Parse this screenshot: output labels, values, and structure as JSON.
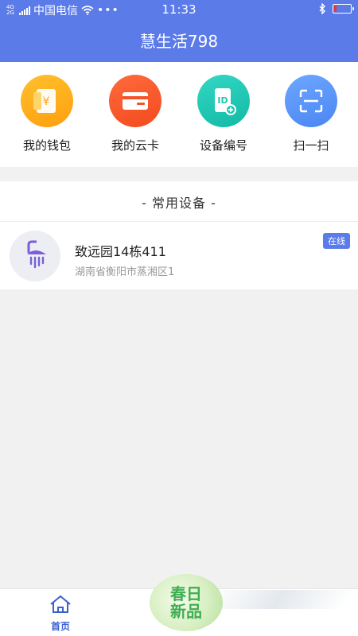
{
  "status_bar": {
    "network_tag": "4G 2G",
    "carrier": "中国电信",
    "time": "11:33"
  },
  "header": {
    "title": "慧生活798"
  },
  "quick_actions": [
    {
      "label": "我的钱包",
      "icon": "wallet-icon",
      "color": "#ffab1a"
    },
    {
      "label": "我的云卡",
      "icon": "card-icon",
      "color": "#f4532a"
    },
    {
      "label": "设备编号",
      "icon": "device-id-icon",
      "color": "#20c7b2"
    },
    {
      "label": "扫一扫",
      "icon": "scan-icon",
      "color": "#5a94f7"
    }
  ],
  "section": {
    "title": "- 常用设备 -"
  },
  "device": {
    "name": "致远园14栋411",
    "address": "湖南省衡阳市蒸湘区1",
    "status": "在线",
    "icon": "shower-icon"
  },
  "bottom_nav": {
    "home_label": "首页",
    "promo_line1": "春日",
    "promo_line2": "新品"
  },
  "colors": {
    "primary": "#5b7be9",
    "page_bg": "#f1f1f1"
  }
}
